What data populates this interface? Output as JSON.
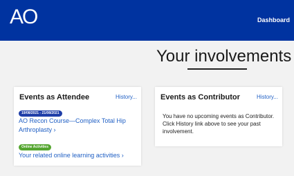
{
  "header": {
    "logo": "AO",
    "nav_dashboard": "Dashboard"
  },
  "page": {
    "title": "Your involvements"
  },
  "attendee": {
    "title": "Events as Attendee",
    "history": "History...",
    "date_badge": "19/08/2021 - 21/08/2021",
    "course": "AO Recon Course—Complex Total Hip Arthroplasty ›",
    "online_badge": "Online Activities",
    "online_link": "Your related online learning activities ›"
  },
  "contributor": {
    "title": "Events as Contributor",
    "history": "History...",
    "message": "You have no upcoming events as Contributor. Click History link above to see your past involvement."
  },
  "colors": {
    "brand_blue": "#0033a0",
    "link_blue": "#1f5fc4",
    "badge_blue": "#1f3ea8",
    "badge_green": "#55a630"
  }
}
